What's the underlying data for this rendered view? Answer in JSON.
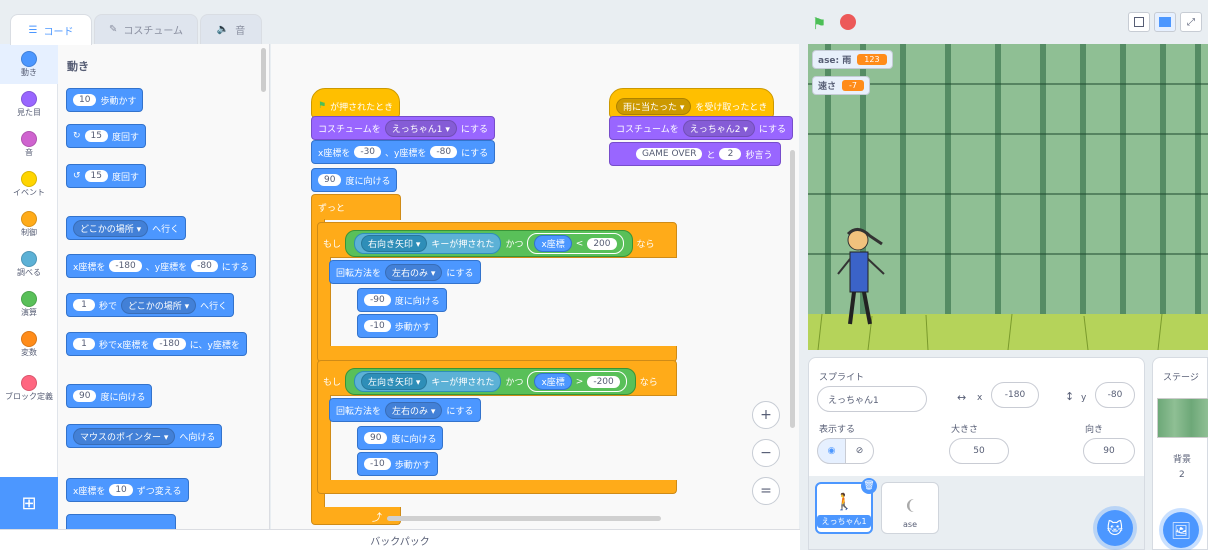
{
  "tabs": [
    {
      "label": "コード"
    },
    {
      "label": "コスチューム"
    },
    {
      "label": "音"
    }
  ],
  "categories": [
    {
      "label": "動き",
      "color": "#4c97ff"
    },
    {
      "label": "見た目",
      "color": "#9966ff"
    },
    {
      "label": "音",
      "color": "#cf63cf"
    },
    {
      "label": "イベント",
      "color": "#ffd500"
    },
    {
      "label": "制御",
      "color": "#ffab19"
    },
    {
      "label": "調べる",
      "color": "#5cb1d6"
    },
    {
      "label": "演算",
      "color": "#59c059"
    },
    {
      "label": "変数",
      "color": "#ff8c1a"
    },
    {
      "label": "ブロック定義",
      "color": "#ff6680"
    }
  ],
  "palette": {
    "title": "動き",
    "move_steps": "10",
    "move_label": "歩動かす",
    "turn_right": "15",
    "turn_label": "度回す",
    "turn_left": "15",
    "goto_menu": "どこかの場所",
    "goto_label": "へ行く",
    "xy_x_label": "x座標を",
    "xy_x": "-180",
    "xy_y_label": "、y座標を",
    "xy_y": "-80",
    "xy_suffix": "にする",
    "glide_secs": "1",
    "glide_sec_label": "秒で",
    "glide_menu": "どこかの場所",
    "glide_label": "へ行く",
    "glide_xy_secs": "1",
    "glide_xy_label": "秒でx座標を",
    "glide_xy_x": "-180",
    "glide_xy_mid": "に、y座標を",
    "point_dir": "90",
    "point_label": "度に向ける",
    "point_towards_menu": "マウスのポインター",
    "point_towards_label": "へ向ける",
    "change_x_label": "x座標を",
    "change_x": "10",
    "change_x_suffix": "ずつ変える"
  },
  "script1": {
    "hat": "が押されたとき",
    "costume_label": "コスチュームを",
    "costume_menu": "えっちゃん1",
    "costume_suffix": "にする",
    "xy_x_label": "x座標を",
    "xy_x": "-30",
    "xy_y_label": "、y座標を",
    "xy_y": "-80",
    "xy_suffix": "にする",
    "point": "90",
    "point_label": "度に向ける",
    "forever": "ずっと",
    "if1": {
      "if": "もし",
      "key": "右向き矢印",
      "pressed": "キーが押された",
      "and": "かつ",
      "xpos": "x座標",
      "op": "<",
      "value": "200",
      "then": "なら",
      "rot_label": "回転方法を",
      "rot_menu": "左右のみ",
      "rot_suffix": "にする",
      "dir": "-90",
      "dir_label": "度に向ける",
      "steps": "-10",
      "steps_label": "歩動かす"
    },
    "if2": {
      "if": "もし",
      "key": "左向き矢印",
      "pressed": "キーが押された",
      "and": "かつ",
      "xpos": "x座標",
      "op": ">",
      "value": "-200",
      "then": "なら",
      "rot_label": "回転方法を",
      "rot_menu": "左右のみ",
      "rot_suffix": "にする",
      "dir": "90",
      "dir_label": "度に向ける",
      "steps": "-10",
      "steps_label": "歩動かす"
    }
  },
  "script2": {
    "msg_menu": "雨に当たった",
    "hat_label": "を受け取ったとき",
    "costume_label": "コスチュームを",
    "costume_menu": "えっちゃん2",
    "costume_suffix": "にする",
    "say_text": "GAME OVER",
    "say_and": "と",
    "say_secs": "2",
    "say_label": "秒言う"
  },
  "zoom": {
    "in": "+",
    "out": "−",
    "reset": "="
  },
  "backpack": "バックパック",
  "monitors": [
    {
      "label": "ase: 雨",
      "value": "123"
    },
    {
      "label": "速さ",
      "value": "-7"
    }
  ],
  "sprite_info": {
    "sprite_label": "スプライト",
    "sprite_name": "えっちゃん1",
    "x_label": "x",
    "x": "-180",
    "y_label": "y",
    "y": "-80",
    "show_label": "表示する",
    "size_label": "大きさ",
    "size": "50",
    "dir_label": "向き",
    "dir": "90"
  },
  "sprites": [
    {
      "name": "えっちゃん1"
    },
    {
      "name": "ase"
    }
  ],
  "stage_panel": {
    "title": "ステージ",
    "backdrop_label": "背景",
    "backdrop_count": "2"
  },
  "colors": {
    "motion": "#4c97ff",
    "looks": "#9966ff",
    "control": "#ffab19",
    "event": "#ffbf00",
    "operators": "#59c059",
    "variables": "#ff8c1a"
  }
}
